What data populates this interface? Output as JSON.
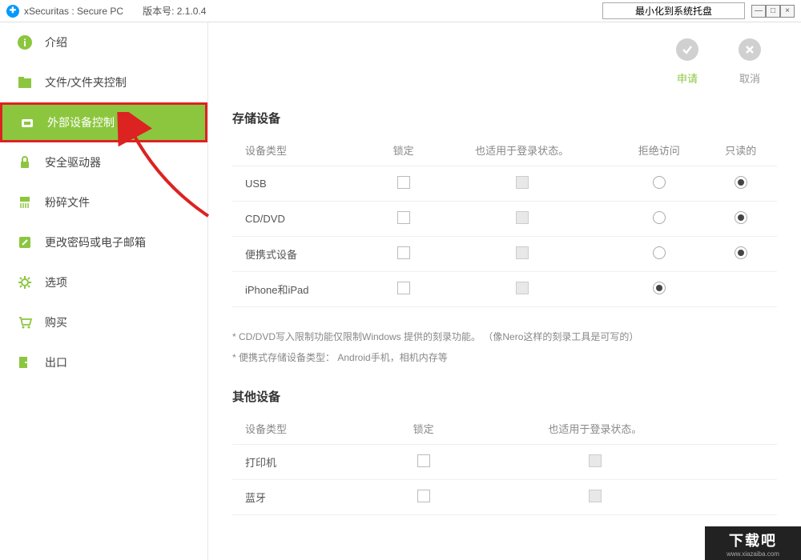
{
  "titlebar": {
    "app_name": "xSecuritas : Secure PC",
    "version_label": "版本号:",
    "version_value": "2.1.0.4",
    "tray_button": "最小化到系统托盘",
    "minimize": "—",
    "maximize": "□",
    "close": "×"
  },
  "sidebar": {
    "items": [
      {
        "label": "介绍",
        "icon": "info"
      },
      {
        "label": "文件/文件夹控制",
        "icon": "folder"
      },
      {
        "label": "外部设备控制",
        "icon": "device",
        "active": true
      },
      {
        "label": "安全驱动器",
        "icon": "lock"
      },
      {
        "label": "粉碎文件",
        "icon": "shred"
      },
      {
        "label": "更改密码或电子邮箱",
        "icon": "edit"
      },
      {
        "label": "选项",
        "icon": "gear"
      },
      {
        "label": "购买",
        "icon": "cart"
      },
      {
        "label": "出口",
        "icon": "exit"
      }
    ]
  },
  "actions": {
    "apply": "申请",
    "cancel": "取消"
  },
  "storage_section": {
    "title": "存储设备",
    "columns": [
      "设备类型",
      "锁定",
      "也适用于登录状态。",
      "拒绝访问",
      "只读的"
    ],
    "rows": [
      {
        "type": "USB",
        "locked": false,
        "login_state": "disabled",
        "deny": false,
        "readonly": true
      },
      {
        "type": "CD/DVD",
        "locked": false,
        "login_state": "disabled",
        "deny": false,
        "readonly": true
      },
      {
        "type": "便携式设备",
        "locked": false,
        "login_state": "disabled",
        "deny": false,
        "readonly": true
      },
      {
        "type": "iPhone和iPad",
        "locked": false,
        "login_state": "disabled",
        "deny": true,
        "readonly": null
      }
    ],
    "notes": [
      "* CD/DVD写入限制功能仅限制Windows 提供的刻录功能。 （像Nero这样的刻录工具是可写的）",
      "* 便携式存储设备类型： Android手机，相机内存等"
    ]
  },
  "other_section": {
    "title": "其他设备",
    "columns": [
      "设备类型",
      "锁定",
      "也适用于登录状态。"
    ],
    "rows": [
      {
        "type": "打印机",
        "locked": false,
        "login_state": "disabled"
      },
      {
        "type": "蓝牙",
        "locked": false,
        "login_state": "disabled"
      }
    ]
  },
  "watermark": {
    "text": "下载吧",
    "url": "www.xiazaiba.com"
  },
  "colors": {
    "accent": "#8cc63f",
    "highlight": "#d22"
  }
}
